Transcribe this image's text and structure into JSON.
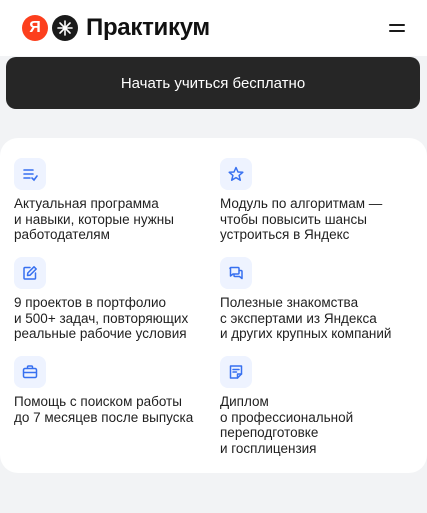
{
  "header": {
    "logo_ya": "Я",
    "logo_text": "Практикум",
    "menu_icon": "hamburger-icon"
  },
  "cta": {
    "label": "Начать учиться бесплатно"
  },
  "features": [
    {
      "icon": "list-icon",
      "text": "Актуальная программа\nи навыки, которые нужны\nработодателям"
    },
    {
      "icon": "star-icon",
      "text": "Модуль по алгоритмам —\nчтобы повысить шансы\nустроиться в Яндекс"
    },
    {
      "icon": "edit-icon",
      "text": "9 проектов в портфолио\nи 500+ задач, повторяющих\nреальные рабочие условия"
    },
    {
      "icon": "chat-icon",
      "text": "Полезные знакомства\nс экспертами из Яндекса\nи других крупных компаний"
    },
    {
      "icon": "briefcase-icon",
      "text": "Помощь с поиском работы\nдо 7 месяцев после выпуска"
    },
    {
      "icon": "diploma-icon",
      "text": "Диплом\nо профессиональной\nпереподготовке\nи госплицензия"
    }
  ],
  "colors": {
    "accent": "#3770f0",
    "logo_red": "#fc3f1d",
    "cta_bg": "#262626"
  }
}
